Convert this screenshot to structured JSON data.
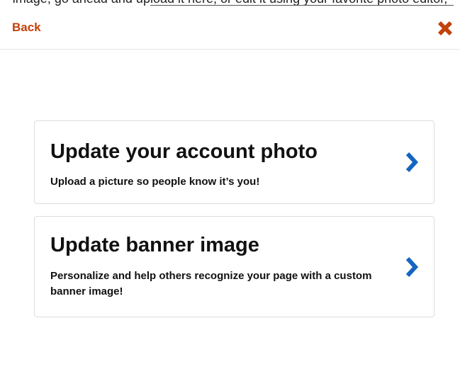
{
  "top_clipped_text": "image, go ahead and upload it here, or edit it using your favorite photo editor,",
  "header": {
    "back_label": "Back",
    "close_icon": "close-x-icon",
    "accent_color": "#c2410c"
  },
  "options": [
    {
      "title": "Update your account photo",
      "description": "Upload a picture so people know it’s you!",
      "icon": "chevron-right-icon"
    },
    {
      "title": "Update banner image",
      "description": "Personalize and help others recognize your page with a custom banner image!",
      "icon": "chevron-right-icon"
    }
  ],
  "colors": {
    "chevron": "#1565c0",
    "text": "#111111",
    "card_border": "#dddddd"
  }
}
